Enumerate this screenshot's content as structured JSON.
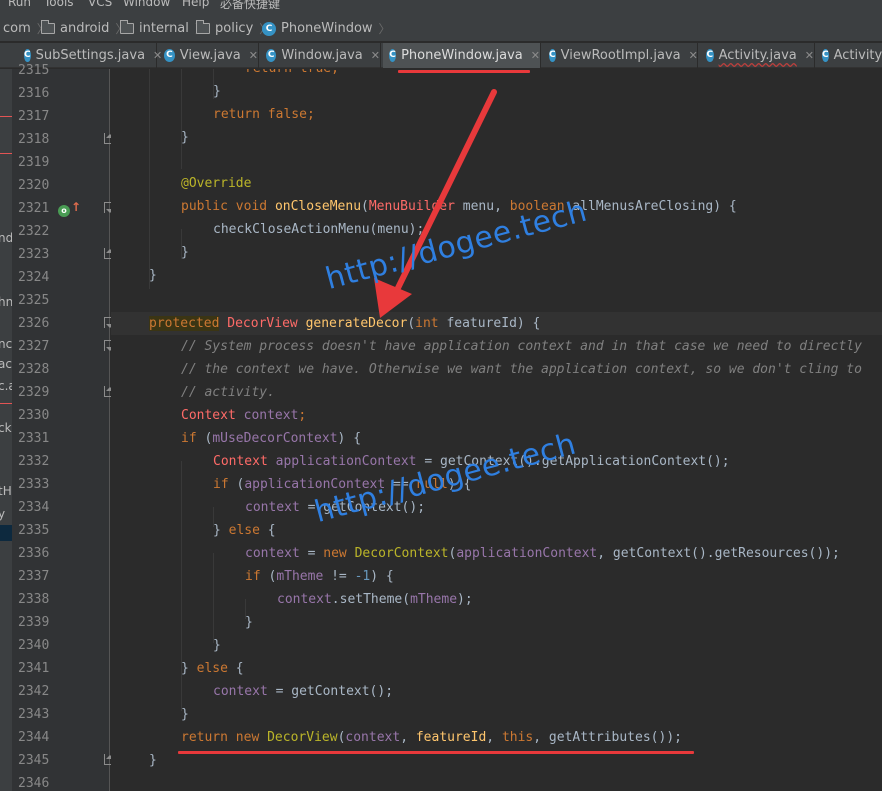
{
  "menu": [
    "Run",
    "Tools",
    "VCS",
    "Window",
    "Help",
    "必备快捷键"
  ],
  "breadcrumb": {
    "items": [
      "com",
      "android",
      "internal",
      "policy",
      "PhoneWindow"
    ]
  },
  "tabs": [
    {
      "label": "SubSettings.java",
      "active": false
    },
    {
      "label": "View.java",
      "active": false
    },
    {
      "label": "Window.java",
      "active": false
    },
    {
      "label": "PhoneWindow.java",
      "active": true
    },
    {
      "label": "ViewRootImpl.java",
      "active": false
    },
    {
      "label": "Activity.java",
      "active": false
    },
    {
      "label": "Activity",
      "active": false
    }
  ],
  "left_panel_fragments": [
    "nd",
    "hn",
    "nc",
    "ac",
    "c.a",
    "ck",
    "tH",
    "y"
  ],
  "line_numbers": [
    "2315",
    "2316",
    "2317",
    "2318",
    "2319",
    "2320",
    "2321",
    "2322",
    "2323",
    "2324",
    "2325",
    "2326",
    "2327",
    "2328",
    "2329",
    "2330",
    "2331",
    "2332",
    "2333",
    "2334",
    "2335",
    "2336",
    "2337",
    "2338",
    "2339",
    "2340",
    "2341",
    "2342",
    "2343",
    "2344",
    "2345",
    "2346"
  ],
  "code": {
    "l2315": [
      "return",
      "true",
      ";"
    ],
    "l2316": "}",
    "l2317": [
      "return",
      "false",
      ";"
    ],
    "l2318": "}",
    "l2320": "@Override",
    "l2321": [
      "public",
      "void",
      "onCloseMenu",
      "(",
      "MenuBuilder",
      " menu, ",
      "boolean",
      " allMenusAreClosing) {"
    ],
    "l2322": [
      "checkCloseActionMenu",
      "(menu);"
    ],
    "l2323": "}",
    "l2324": "}",
    "l2326": [
      "protected",
      "DecorView",
      "generateDecor",
      "(",
      "int",
      " featureId) {"
    ],
    "l2327": "// System process doesn't have application context and in that case we need to directly",
    "l2328": "// the context we have. Otherwise we want the application context, so we don't cling to",
    "l2329": "// activity.",
    "l2330": [
      "Context",
      "context",
      ";"
    ],
    "l2331": [
      "if",
      " (",
      "mUseDecorContext",
      ") {"
    ],
    "l2332": [
      "Context",
      "applicationContext",
      " = getContext().getApplicationContext();"
    ],
    "l2333": [
      "if",
      " (",
      "applicationContext",
      " == ",
      "null",
      ") {"
    ],
    "l2334": [
      "context",
      " = getContext();"
    ],
    "l2335": [
      "} ",
      "else",
      " {"
    ],
    "l2336": [
      "context",
      " = ",
      "new",
      "DecorContext",
      "(",
      "applicationContext",
      ", getContext().getResources());"
    ],
    "l2337": [
      "if",
      " (",
      "mTheme",
      " != ",
      "-1",
      ") {"
    ],
    "l2338": [
      "context",
      ".setTheme(",
      "mTheme",
      ");"
    ],
    "l2339": "}",
    "l2340": "}",
    "l2341": [
      "} ",
      "else",
      " {"
    ],
    "l2342": [
      "context",
      " = getContext();"
    ],
    "l2343": "}",
    "l2344": [
      "return",
      "new",
      "DecorView",
      "(",
      "context",
      ", ",
      "featureId",
      ", ",
      "this",
      ", getAttributes());"
    ],
    "l2345": "}"
  },
  "watermark": "http://dogee.tech",
  "colors": {
    "keyword": "#cc7832",
    "annotation": "#bbb529",
    "method": "#ffc66d",
    "field": "#9876aa",
    "number": "#6897bb",
    "comment": "#808080",
    "error": "#ff6b68",
    "watermark": "#2f7fe0",
    "highlight": "#e8393b"
  }
}
